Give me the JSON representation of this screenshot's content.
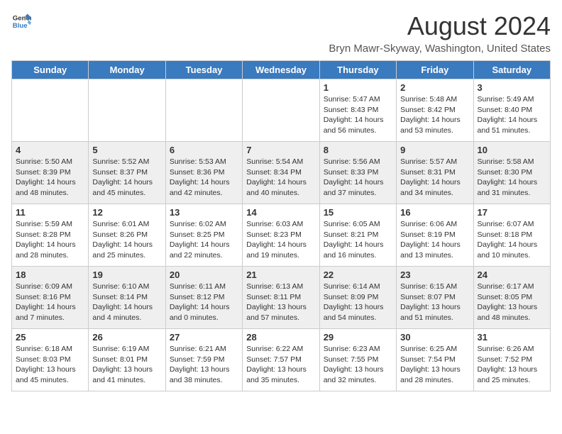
{
  "header": {
    "logo_general": "General",
    "logo_blue": "Blue",
    "main_title": "August 2024",
    "subtitle": "Bryn Mawr-Skyway, Washington, United States"
  },
  "weekdays": [
    "Sunday",
    "Monday",
    "Tuesday",
    "Wednesday",
    "Thursday",
    "Friday",
    "Saturday"
  ],
  "weeks": [
    [
      {
        "day": "",
        "info": ""
      },
      {
        "day": "",
        "info": ""
      },
      {
        "day": "",
        "info": ""
      },
      {
        "day": "",
        "info": ""
      },
      {
        "day": "1",
        "info": "Sunrise: 5:47 AM\nSunset: 8:43 PM\nDaylight: 14 hours\nand 56 minutes."
      },
      {
        "day": "2",
        "info": "Sunrise: 5:48 AM\nSunset: 8:42 PM\nDaylight: 14 hours\nand 53 minutes."
      },
      {
        "day": "3",
        "info": "Sunrise: 5:49 AM\nSunset: 8:40 PM\nDaylight: 14 hours\nand 51 minutes."
      }
    ],
    [
      {
        "day": "4",
        "info": "Sunrise: 5:50 AM\nSunset: 8:39 PM\nDaylight: 14 hours\nand 48 minutes."
      },
      {
        "day": "5",
        "info": "Sunrise: 5:52 AM\nSunset: 8:37 PM\nDaylight: 14 hours\nand 45 minutes."
      },
      {
        "day": "6",
        "info": "Sunrise: 5:53 AM\nSunset: 8:36 PM\nDaylight: 14 hours\nand 42 minutes."
      },
      {
        "day": "7",
        "info": "Sunrise: 5:54 AM\nSunset: 8:34 PM\nDaylight: 14 hours\nand 40 minutes."
      },
      {
        "day": "8",
        "info": "Sunrise: 5:56 AM\nSunset: 8:33 PM\nDaylight: 14 hours\nand 37 minutes."
      },
      {
        "day": "9",
        "info": "Sunrise: 5:57 AM\nSunset: 8:31 PM\nDaylight: 14 hours\nand 34 minutes."
      },
      {
        "day": "10",
        "info": "Sunrise: 5:58 AM\nSunset: 8:30 PM\nDaylight: 14 hours\nand 31 minutes."
      }
    ],
    [
      {
        "day": "11",
        "info": "Sunrise: 5:59 AM\nSunset: 8:28 PM\nDaylight: 14 hours\nand 28 minutes."
      },
      {
        "day": "12",
        "info": "Sunrise: 6:01 AM\nSunset: 8:26 PM\nDaylight: 14 hours\nand 25 minutes."
      },
      {
        "day": "13",
        "info": "Sunrise: 6:02 AM\nSunset: 8:25 PM\nDaylight: 14 hours\nand 22 minutes."
      },
      {
        "day": "14",
        "info": "Sunrise: 6:03 AM\nSunset: 8:23 PM\nDaylight: 14 hours\nand 19 minutes."
      },
      {
        "day": "15",
        "info": "Sunrise: 6:05 AM\nSunset: 8:21 PM\nDaylight: 14 hours\nand 16 minutes."
      },
      {
        "day": "16",
        "info": "Sunrise: 6:06 AM\nSunset: 8:19 PM\nDaylight: 14 hours\nand 13 minutes."
      },
      {
        "day": "17",
        "info": "Sunrise: 6:07 AM\nSunset: 8:18 PM\nDaylight: 14 hours\nand 10 minutes."
      }
    ],
    [
      {
        "day": "18",
        "info": "Sunrise: 6:09 AM\nSunset: 8:16 PM\nDaylight: 14 hours\nand 7 minutes."
      },
      {
        "day": "19",
        "info": "Sunrise: 6:10 AM\nSunset: 8:14 PM\nDaylight: 14 hours\nand 4 minutes."
      },
      {
        "day": "20",
        "info": "Sunrise: 6:11 AM\nSunset: 8:12 PM\nDaylight: 14 hours\nand 0 minutes."
      },
      {
        "day": "21",
        "info": "Sunrise: 6:13 AM\nSunset: 8:11 PM\nDaylight: 13 hours\nand 57 minutes."
      },
      {
        "day": "22",
        "info": "Sunrise: 6:14 AM\nSunset: 8:09 PM\nDaylight: 13 hours\nand 54 minutes."
      },
      {
        "day": "23",
        "info": "Sunrise: 6:15 AM\nSunset: 8:07 PM\nDaylight: 13 hours\nand 51 minutes."
      },
      {
        "day": "24",
        "info": "Sunrise: 6:17 AM\nSunset: 8:05 PM\nDaylight: 13 hours\nand 48 minutes."
      }
    ],
    [
      {
        "day": "25",
        "info": "Sunrise: 6:18 AM\nSunset: 8:03 PM\nDaylight: 13 hours\nand 45 minutes."
      },
      {
        "day": "26",
        "info": "Sunrise: 6:19 AM\nSunset: 8:01 PM\nDaylight: 13 hours\nand 41 minutes."
      },
      {
        "day": "27",
        "info": "Sunrise: 6:21 AM\nSunset: 7:59 PM\nDaylight: 13 hours\nand 38 minutes."
      },
      {
        "day": "28",
        "info": "Sunrise: 6:22 AM\nSunset: 7:57 PM\nDaylight: 13 hours\nand 35 minutes."
      },
      {
        "day": "29",
        "info": "Sunrise: 6:23 AM\nSunset: 7:55 PM\nDaylight: 13 hours\nand 32 minutes."
      },
      {
        "day": "30",
        "info": "Sunrise: 6:25 AM\nSunset: 7:54 PM\nDaylight: 13 hours\nand 28 minutes."
      },
      {
        "day": "31",
        "info": "Sunrise: 6:26 AM\nSunset: 7:52 PM\nDaylight: 13 hours\nand 25 minutes."
      }
    ]
  ]
}
